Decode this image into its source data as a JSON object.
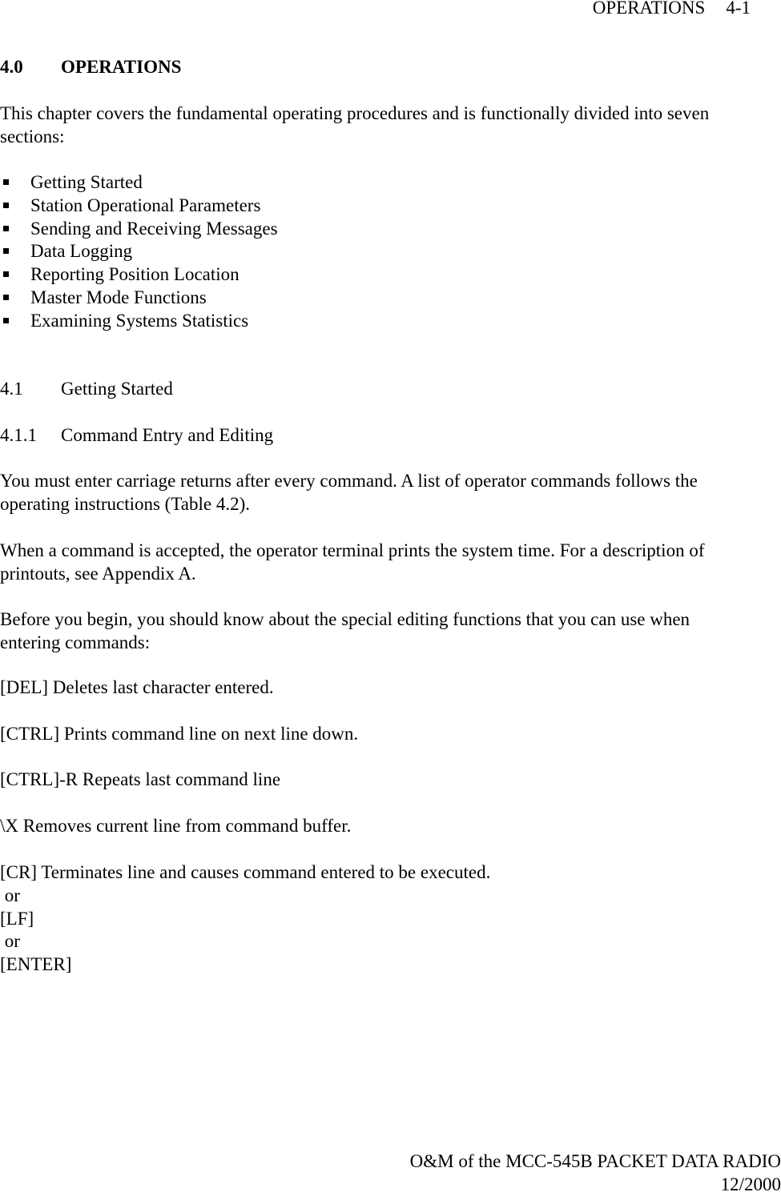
{
  "header": {
    "section": "OPERATIONS",
    "page": "4-1"
  },
  "chapter": {
    "number": "4.0",
    "title": "OPERATIONS"
  },
  "intro": {
    "line1": "This chapter covers the fundamental operating procedures and is functionally divided into seven",
    "line2": "sections:"
  },
  "sections_list": [
    "Getting Started",
    "Station Operational Parameters",
    "Sending and Receiving Messages",
    "Data Logging",
    "Reporting Position Location",
    "Master Mode Functions",
    "Examining Systems Statistics"
  ],
  "section_4_1": {
    "number": "4.1",
    "title": "Getting Started"
  },
  "section_4_1_1": {
    "number": "4.1.1",
    "title": "Command Entry and Editing"
  },
  "paragraphs": {
    "p1_line1": "You must enter carriage returns after every command. A list of operator commands follows the",
    "p1_line2": "operating instructions (Table 4.2).",
    "p2_line1": "When a command is accepted, the operator terminal prints the system time. For a description of",
    "p2_line2": "printouts, see Appendix A.",
    "p3_line1": "Before you begin, you should know about the special editing functions that you can use when",
    "p3_line2": "entering commands:"
  },
  "editing_functions": [
    "[DEL] Deletes last character entered.",
    "[CTRL] Prints command line on next line down.",
    "[CTRL]-R Repeats last command line",
    "\\X  Removes current line from command buffer.",
    "[CR]  Terminates line and causes command entered to be executed."
  ],
  "alternates": {
    "or1": " or",
    "lf": "[LF]",
    "or2": " or",
    "enter": "[ENTER]"
  },
  "footer": {
    "line1": "O&M of the MCC-545B PACKET DATA RADIO",
    "line2": "12/2000"
  }
}
